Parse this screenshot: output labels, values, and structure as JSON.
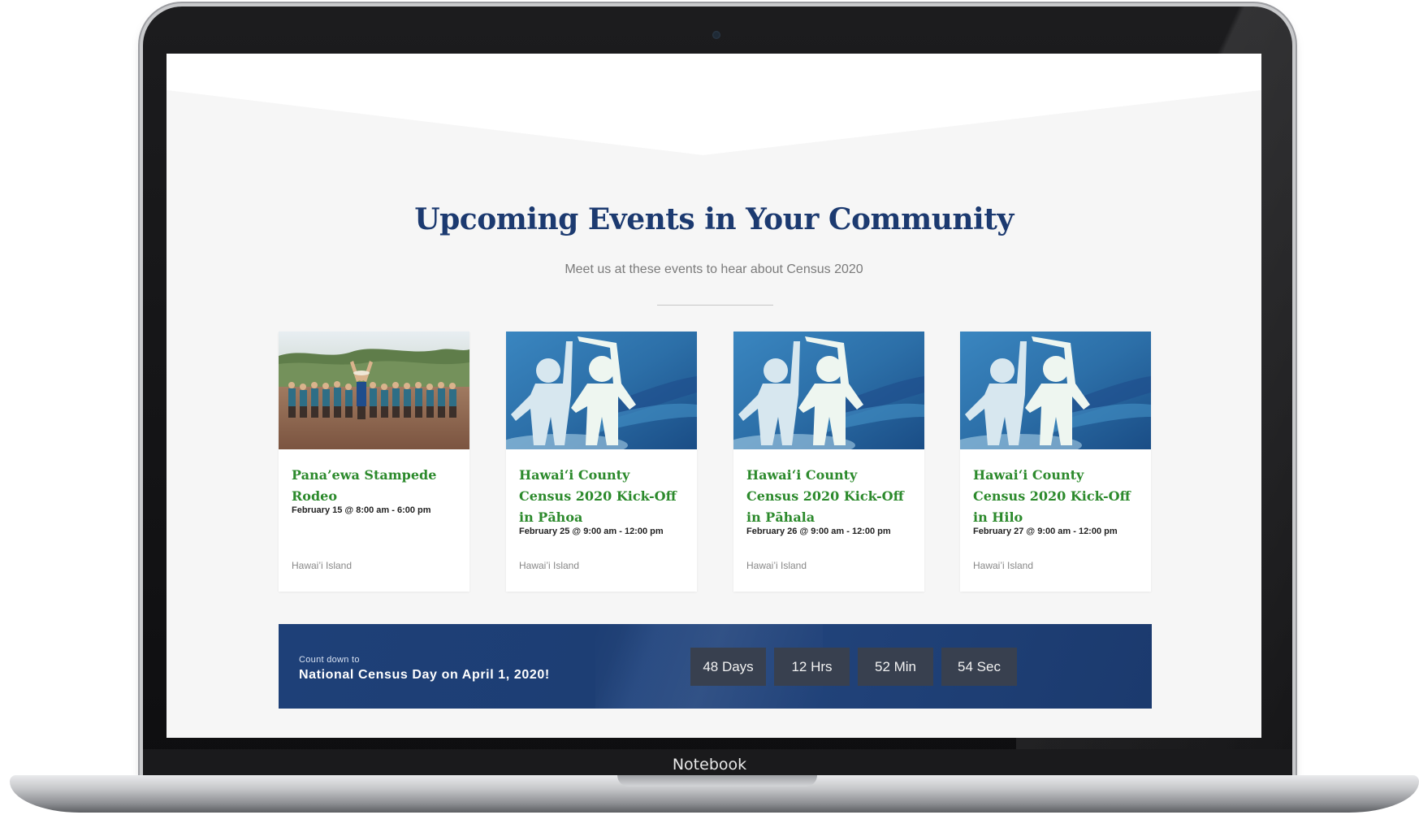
{
  "device": {
    "label": "Notebook"
  },
  "section": {
    "title": "Upcoming Events in Your Community",
    "subtitle": "Meet us at these events to hear about Census 2020"
  },
  "events": [
    {
      "title": "Pana’ewa Stampede Rodeo",
      "date": "February 15 @ 8:00 am - 6:00 pm",
      "location": "Hawai’i Island",
      "image": "rodeo-group-photo"
    },
    {
      "title": "Hawaiʻi County Census 2020 Kick-Off in Pāhoa",
      "date": "February 25 @ 9:00 am - 12:00 pm",
      "location": "Hawai’i Island",
      "image": "paper-people-high-five"
    },
    {
      "title": "Hawaiʻi County Census 2020 Kick-Off in Pāhala",
      "date": "February 26 @ 9:00 am - 12:00 pm",
      "location": "Hawai’i Island",
      "image": "paper-people-high-five"
    },
    {
      "title": "Hawaiʻi County Census 2020 Kick-Off in Hilo",
      "date": "February 27 @ 9:00 am - 12:00 pm",
      "location": "Hawai’i Island",
      "image": "paper-people-high-five"
    }
  ],
  "countdown": {
    "kicker": "Count down to",
    "headline": "National Census Day on April 1, 2020!",
    "days": "48 Days",
    "hours": "12 Hrs",
    "minutes": "52 Min",
    "seconds": "54 Sec"
  },
  "colors": {
    "title": "#1c3a70",
    "event_title": "#2c8a2c",
    "banner": "#1e4078",
    "count_box": "#38404f"
  }
}
